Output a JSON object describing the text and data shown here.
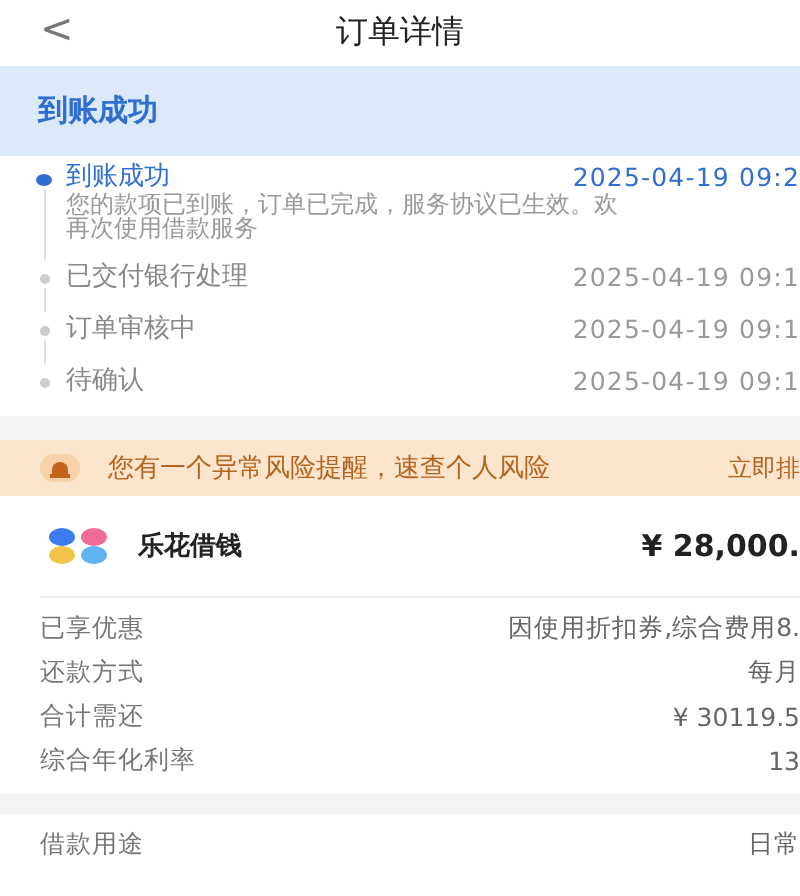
{
  "header": {
    "back": "<",
    "title": "订单详情"
  },
  "status_banner": {
    "title": "到账成功"
  },
  "timeline": [
    {
      "title": "到账成功",
      "time": "2025-04-19 09:2",
      "selected": true,
      "description": [
        "您的款项已到账，订单已完成，服务协议已生效。欢",
        "再次使用借款服务"
      ]
    },
    {
      "title": "已交付银行处理",
      "time": "2025-04-19 09:1",
      "selected": false
    },
    {
      "title": "订单审核中",
      "time": "2025-04-19 09:1",
      "selected": false
    },
    {
      "title": "待确认",
      "time": "2025-04-19 09:1",
      "selected": false
    }
  ],
  "risk_banner": {
    "text": "您有一个异常风险提醒，速查个人风险",
    "action": "立即排"
  },
  "product": {
    "name": "乐花借钱",
    "amount": "¥ 28,000."
  },
  "details": [
    {
      "label": "已享优惠",
      "value": "因使用折扣券,综合费用8."
    },
    {
      "label": "还款方式",
      "value": "每月"
    },
    {
      "label": "合计需还",
      "value": "¥ 30119.5"
    },
    {
      "label": "综合年化利率",
      "value": "13"
    }
  ],
  "details_2": [
    {
      "label": "借款用途",
      "value": "日常"
    }
  ]
}
